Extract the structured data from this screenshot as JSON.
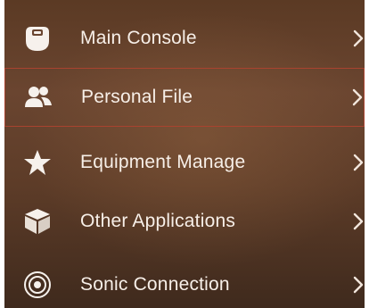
{
  "menu": {
    "items": [
      {
        "label": "Main Console",
        "icon": "console-icon",
        "selected": false
      },
      {
        "label": "Personal File",
        "icon": "people-icon",
        "selected": true
      },
      {
        "label": "Equipment Manage",
        "icon": "star-icon",
        "selected": false
      },
      {
        "label": "Other Applications",
        "icon": "box-icon",
        "selected": false
      },
      {
        "label": "Sonic Connection",
        "icon": "sonic-icon",
        "selected": false
      }
    ],
    "colors": {
      "text": "#f7efe8",
      "selection_border": "#a9432f",
      "background": "#5d3c28"
    }
  }
}
